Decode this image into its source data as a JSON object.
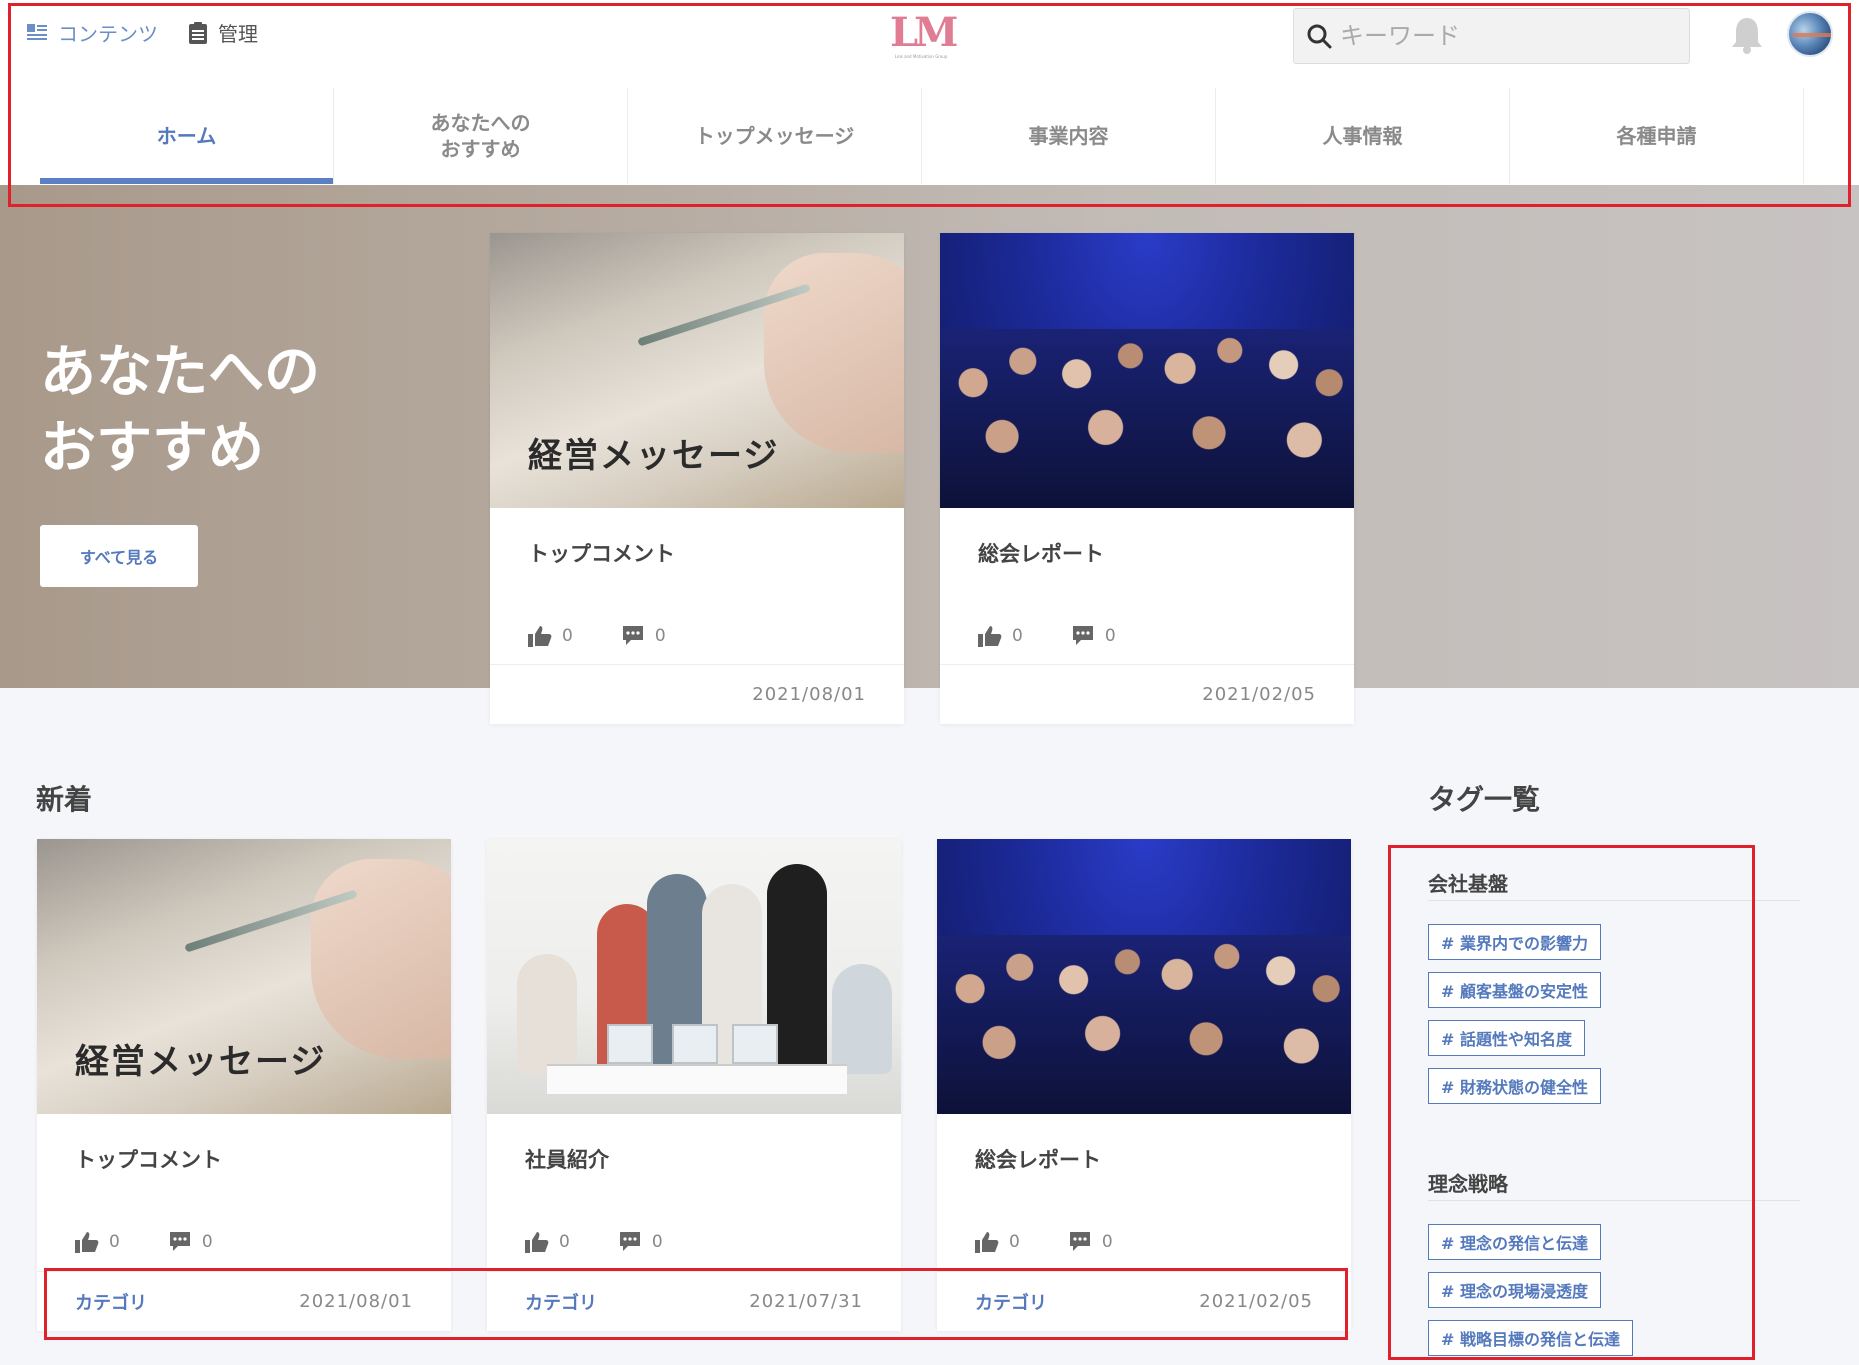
{
  "topbar": {
    "content_label": "コンテンツ",
    "admin_label": "管理",
    "logo_text": "LM",
    "logo_sub": "Link and Motivation Group",
    "search_placeholder": "キーワード"
  },
  "nav": {
    "tabs": [
      {
        "label": "ホーム",
        "active": true
      },
      {
        "label": "あなたへの\nおすすめ"
      },
      {
        "label": "トップメッセージ"
      },
      {
        "label": "事業内容"
      },
      {
        "label": "人事情報"
      },
      {
        "label": "各種申請"
      }
    ]
  },
  "hero": {
    "title": "あなたへの\nおすすめ",
    "see_all_label": "すべて見る",
    "cards": [
      {
        "image_caption": "経営メッセージ",
        "title": "トップコメント",
        "likes": "0",
        "comments": "0",
        "date": "2021/08/01"
      },
      {
        "image_caption": "",
        "title": "総会レポート",
        "likes": "0",
        "comments": "0",
        "date": "2021/02/05"
      }
    ]
  },
  "new_section": {
    "title": "新着",
    "cards": [
      {
        "image_caption": "経営メッセージ",
        "title": "トップコメント",
        "likes": "0",
        "comments": "0",
        "category": "カテゴリ",
        "date": "2021/08/01"
      },
      {
        "image_caption": "",
        "title": "社員紹介",
        "likes": "0",
        "comments": "0",
        "category": "カテゴリ",
        "date": "2021/07/31"
      },
      {
        "image_caption": "",
        "title": "総会レポート",
        "likes": "0",
        "comments": "0",
        "category": "カテゴリ",
        "date": "2021/02/05"
      }
    ]
  },
  "tags": {
    "title": "タグ一覧",
    "groups": [
      {
        "name": "会社基盤",
        "tags": [
          "# 業界内での影響力",
          "# 顧客基盤の安定性",
          "# 話題性や知名度",
          "# 財務状態の健全性"
        ]
      },
      {
        "name": "理念戦略",
        "tags": [
          "# 理念の発信と伝達",
          "# 理念の現場浸透度",
          "# 戦略目標の発信と伝達"
        ]
      }
    ]
  },
  "colors": {
    "accent": "#5479bd",
    "highlight_box": "#e0212b"
  }
}
